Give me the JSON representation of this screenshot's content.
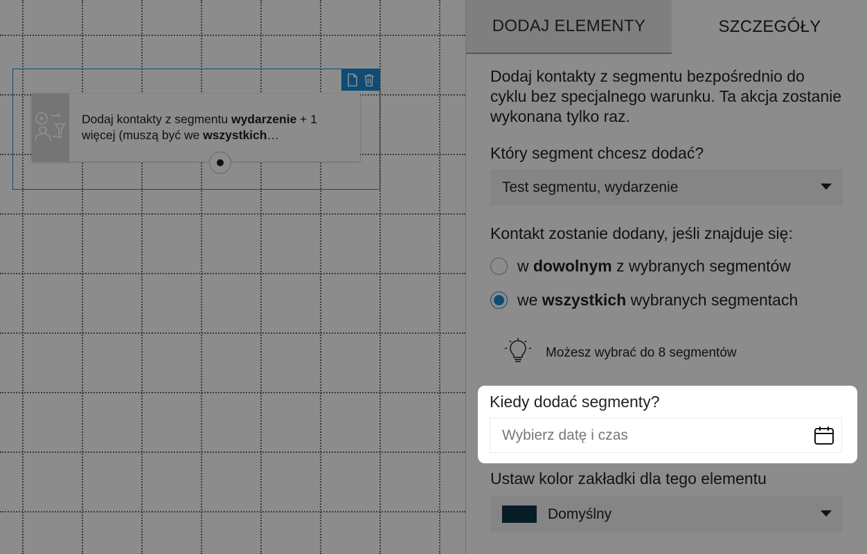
{
  "colors": {
    "accent": "#1a8ad6",
    "tab_color_swatch": "#0b3646"
  },
  "node": {
    "icon": "segment-add-icon",
    "text_prefix": "Dodaj kontakty z segmentu ",
    "text_bold_1": "wydarzenie",
    "text_middle": " + 1 więcej (muszą być we ",
    "text_bold_2": "wszystkich",
    "text_ellipsis": "…",
    "toolbar": {
      "copy_icon": "document-icon",
      "delete_icon": "trash-icon"
    }
  },
  "panel": {
    "tabs": [
      {
        "label": "DODAJ ELEMENTY",
        "active": true
      },
      {
        "label": "SZCZEGÓŁY",
        "active": false
      }
    ],
    "description": "Dodaj kontakty z segmentu bezpośrednio do cyklu bez specjalnego warunku. Ta akcja zostanie wykonana tylko raz.",
    "segment_question": "Który segment chcesz dodać?",
    "segment_selected": "Test segmentu, wydarzenie",
    "condition_label": "Kontakt zostanie dodany, jeśli znajduje się:",
    "radio_any": {
      "prefix": "w ",
      "bold": "dowolnym",
      "suffix": " z wybranych segmentów",
      "checked": false
    },
    "radio_all": {
      "prefix": "we ",
      "bold": "wszystkich",
      "suffix": " wybranych segmentach",
      "checked": true
    },
    "hint_icon": "lightbulb-icon",
    "hint_text": "Możesz wybrać do 8 segmentów",
    "when_label": "Kiedy dodać segmenty?",
    "when_placeholder": "Wybierz datę i czas",
    "calendar_icon": "calendar-icon",
    "color_label": "Ustaw kolor zakładki dla tego elementu",
    "color_selected": "Domyślny"
  }
}
